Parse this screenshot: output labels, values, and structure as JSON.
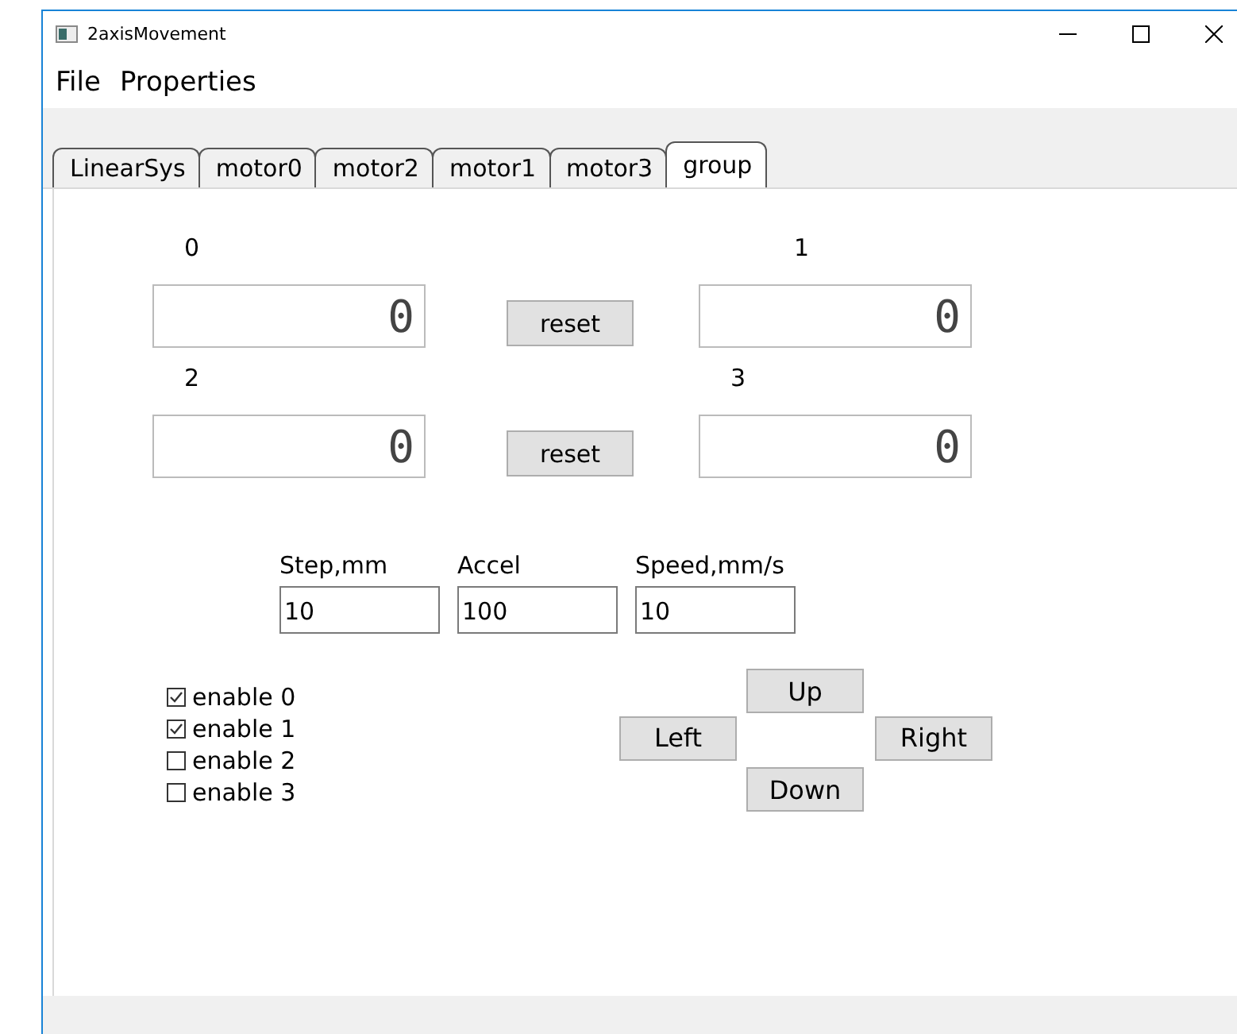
{
  "window": {
    "title": "2axisMovement"
  },
  "menu": [
    "File",
    "Properties"
  ],
  "tabs": [
    {
      "label": "LinearSys",
      "selected": false
    },
    {
      "label": "motor0",
      "selected": false
    },
    {
      "label": "motor2",
      "selected": false
    },
    {
      "label": "motor1",
      "selected": false
    },
    {
      "label": "motor3",
      "selected": false
    },
    {
      "label": "group",
      "selected": true
    }
  ],
  "counters": [
    {
      "label": "0",
      "value": "0"
    },
    {
      "label": "1",
      "value": "0"
    },
    {
      "label": "2",
      "value": "0"
    },
    {
      "label": "3",
      "value": "0"
    }
  ],
  "reset_buttons": [
    "reset",
    "reset"
  ],
  "params": [
    {
      "label": "Step,mm",
      "value": "10"
    },
    {
      "label": "Accel",
      "value": "100"
    },
    {
      "label": "Speed,mm/s",
      "value": "10"
    }
  ],
  "enables": [
    {
      "label": "enable 0",
      "checked": true
    },
    {
      "label": "enable 1",
      "checked": true
    },
    {
      "label": "enable 2",
      "checked": false
    },
    {
      "label": "enable 3",
      "checked": false
    }
  ],
  "direction_buttons": {
    "up": "Up",
    "left": "Left",
    "right": "Right",
    "down": "Down"
  }
}
